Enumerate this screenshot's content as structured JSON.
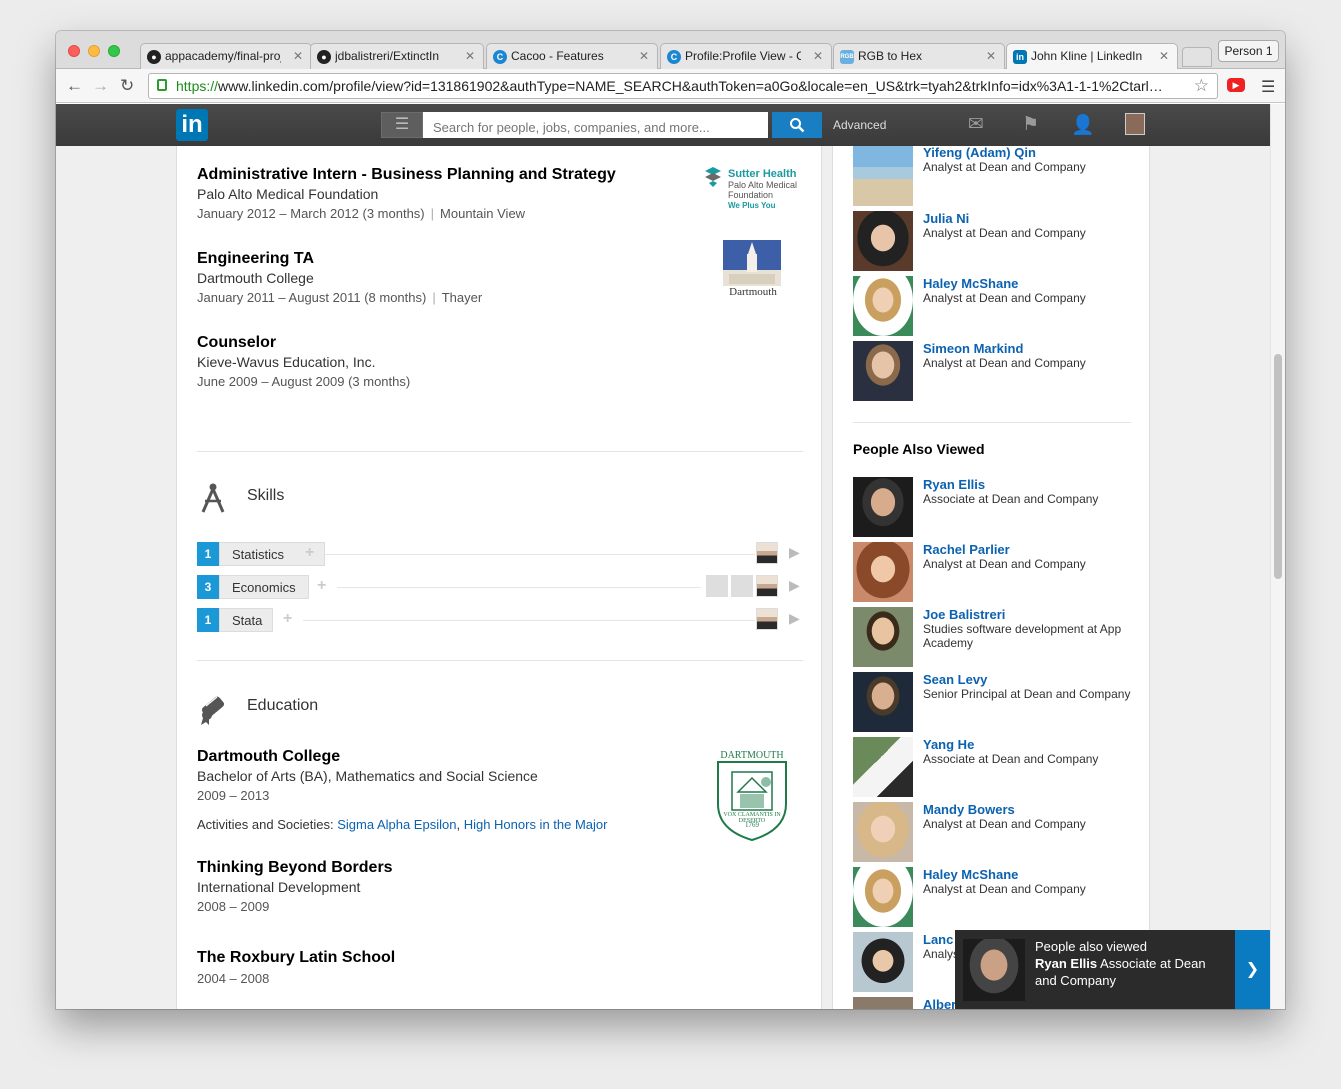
{
  "browser": {
    "tabs": [
      {
        "label": "appacademy/final-proj",
        "favicon": "github-icon"
      },
      {
        "label": "jdbalistreri/ExtinctIn",
        "favicon": "github-icon"
      },
      {
        "label": "Cacoo - Features",
        "favicon": "cacoo-icon"
      },
      {
        "label": "Profile:Profile View - Ca",
        "favicon": "cacoo-icon"
      },
      {
        "label": "RGB to Hex",
        "favicon": "rgb-hex-icon"
      },
      {
        "label": "John Kline | LinkedIn",
        "favicon": "linkedin-icon"
      }
    ],
    "person": "Person 1",
    "url_scheme": "https://",
    "url_rest": "www.linkedin.com/profile/view?id=131861902&authType=NAME_SEARCH&authToken=a0Go&locale=en_US&trk=tyah2&trkInfo=idx%3A1-1-1%2Ctarl…"
  },
  "linkedin_bar": {
    "logo": "in",
    "search_placeholder": "Search for people, jobs, companies, and more...",
    "advanced": "Advanced"
  },
  "experience": [
    {
      "title": "Administrative Intern - Business Planning and Strategy",
      "org": "Palo Alto Medical Foundation",
      "dates": "January 2012 – March 2012 (3 months)",
      "location": "Mountain View",
      "logo": {
        "line1": "Sutter Health",
        "line2": "Palo Alto Medical",
        "line3": "Foundation",
        "line4": "We Plus You"
      }
    },
    {
      "title": "Engineering TA",
      "org": "Dartmouth College",
      "dates": "January 2011 – August 2011 (8 months)",
      "location": "Thayer",
      "logo": {
        "line1": "Dartmouth"
      }
    },
    {
      "title": "Counselor",
      "org": "Kieve-Wavus Education, Inc.",
      "dates": "June 2009 – August 2009 (3 months)",
      "location": ""
    }
  ],
  "skills": {
    "heading": "Skills",
    "items": [
      {
        "count": "1",
        "name": "Statistics"
      },
      {
        "count": "3",
        "name": "Economics"
      },
      {
        "count": "1",
        "name": "Stata"
      }
    ]
  },
  "education": {
    "heading": "Education",
    "items": [
      {
        "school": "Dartmouth College",
        "degree": "Bachelor of Arts (BA), Mathematics and Social Science",
        "dates": "2009 – 2013",
        "activities_label": "Activities and Societies:",
        "activity1": "Sigma Alpha Epsilon",
        "activity2": "High Honors in the Major",
        "seal": {
          "top": "DARTMOUTH",
          "motto": "VOX CLAMANTIS IN DESERTO",
          "year": "1769"
        }
      },
      {
        "school": "Thinking Beyond Borders",
        "degree": "International Development",
        "dates": "2008 – 2009"
      },
      {
        "school": "The Roxbury Latin School",
        "degree": "",
        "dates": "2004 – 2008"
      }
    ]
  },
  "sidebar": {
    "colleagues": [
      {
        "name": "Yifeng (Adam) Qin",
        "headline": "Analyst at Dean and Company"
      },
      {
        "name": "Julia Ni",
        "headline": "Analyst at Dean and Company"
      },
      {
        "name": "Haley McShane",
        "headline": "Analyst at Dean and Company"
      },
      {
        "name": "Simeon Markind",
        "headline": "Analyst at Dean and Company"
      }
    ],
    "also_viewed_title": "People Also Viewed",
    "also_viewed": [
      {
        "name": "Ryan Ellis",
        "headline": "Associate at Dean and Company"
      },
      {
        "name": "Rachel Parlier",
        "headline": "Analyst at Dean and Company"
      },
      {
        "name": "Joe Balistreri",
        "headline": "Studies software development at App Academy"
      },
      {
        "name": "Sean Levy",
        "headline": "Senior Principal at Dean and Company"
      },
      {
        "name": "Yang He",
        "headline": "Associate at Dean and Company"
      },
      {
        "name": "Mandy Bowers",
        "headline": "Analyst at Dean and Company"
      },
      {
        "name": "Haley McShane",
        "headline": "Analyst at Dean and Company"
      },
      {
        "name": "Lanc",
        "headline": "Analys"
      },
      {
        "name": "Alber",
        "headline": ""
      }
    ]
  },
  "popup": {
    "line1": "People also viewed",
    "name": "Ryan Ellis",
    "headline": "Associate at Dean and Company"
  }
}
